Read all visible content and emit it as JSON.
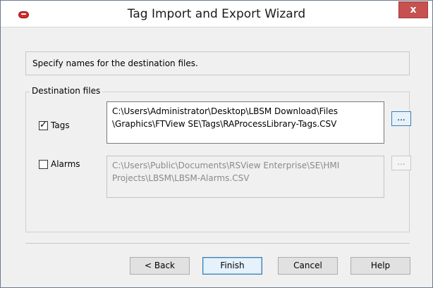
{
  "window": {
    "title": "Tag Import and Export Wizard",
    "close_label": "x"
  },
  "instruction": "Specify names for the destination files.",
  "destination_group": {
    "label": "Destination files",
    "tags": {
      "label": "Tags",
      "checked": true,
      "path_line1": "C:\\Users\\Administrator\\Desktop\\LBSM Download\\Files",
      "path_line2": "\\Graphics\\FTView SE\\Tags\\RAProcessLibrary-Tags.CSV",
      "browse_label": "..."
    },
    "alarms": {
      "label": "Alarms",
      "checked": false,
      "path_line1": "C:\\Users\\Public\\Documents\\RSView Enterprise\\SE\\HMI",
      "path_line2": "Projects\\LBSM\\LBSM-Alarms.CSV",
      "browse_label": "..."
    }
  },
  "buttons": {
    "back": "< Back",
    "finish": "Finish",
    "cancel": "Cancel",
    "help": "Help"
  },
  "colors": {
    "close_button": "#c75050",
    "app_icon": "#d42a2a",
    "default_button_border": "#3c7fb1"
  }
}
